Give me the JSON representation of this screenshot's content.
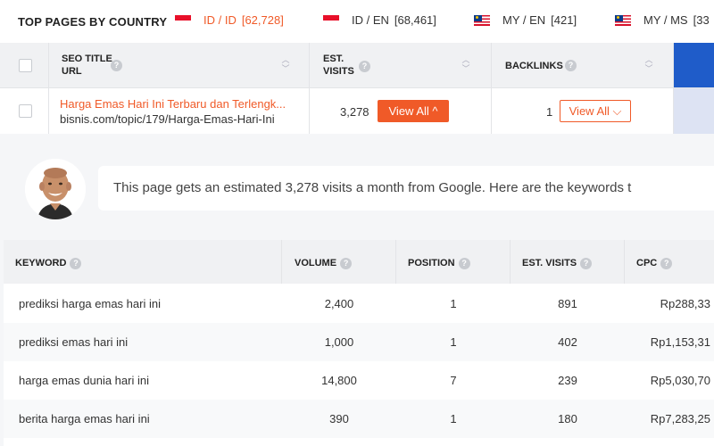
{
  "topbar": {
    "title": "TOP PAGES BY COUNTRY",
    "tabs": [
      {
        "label": "ID / ID",
        "count": "[62,728]",
        "flag": "indonesia-flag",
        "active": true
      },
      {
        "label": "ID / EN",
        "count": "[68,461]",
        "flag": "indonesia-flag",
        "active": false
      },
      {
        "label": "MY / EN",
        "count": "[421]",
        "flag": "malaysia-flag",
        "active": false
      },
      {
        "label": "MY / MS",
        "count": "[33",
        "flag": "malaysia-flag",
        "active": false
      }
    ]
  },
  "pages_table": {
    "headers": {
      "seo_title": "SEO TITLE",
      "url": "URL",
      "est": "EST.",
      "visits": "VISITS",
      "backlinks": "BACKLINKS"
    },
    "row": {
      "title": "Harga Emas Hari Ini Terbaru dan Terlengk...",
      "url": "bisnis.com/topic/179/Harga-Emas-Hari-Ini",
      "visits": "3,278",
      "visits_button": "View All ^",
      "backlinks": "1",
      "backlinks_button": "View All ⌵"
    }
  },
  "message": {
    "text": "This page gets an estimated 3,278 visits a month from Google. Here are the keywords t"
  },
  "keywords_table": {
    "headers": {
      "keyword": "KEYWORD",
      "volume": "VOLUME",
      "position": "POSITION",
      "est_visits": "EST. VISITS",
      "cpc": "CPC"
    },
    "rows": [
      {
        "keyword": "prediksi harga emas hari ini",
        "volume": "2,400",
        "position": "1",
        "visits": "891",
        "cpc": "Rp288,33"
      },
      {
        "keyword": "prediksi emas hari ini",
        "volume": "1,000",
        "position": "1",
        "visits": "402",
        "cpc": "Rp1,153,31"
      },
      {
        "keyword": "harga emas dunia hari ini",
        "volume": "14,800",
        "position": "7",
        "visits": "239",
        "cpc": "Rp5,030,70"
      },
      {
        "keyword": "berita harga emas hari ini",
        "volume": "390",
        "position": "1",
        "visits": "180",
        "cpc": "Rp7,283,25"
      }
    ]
  },
  "colors": {
    "accent": "#f05a28",
    "blue": "#1f5cc9"
  }
}
